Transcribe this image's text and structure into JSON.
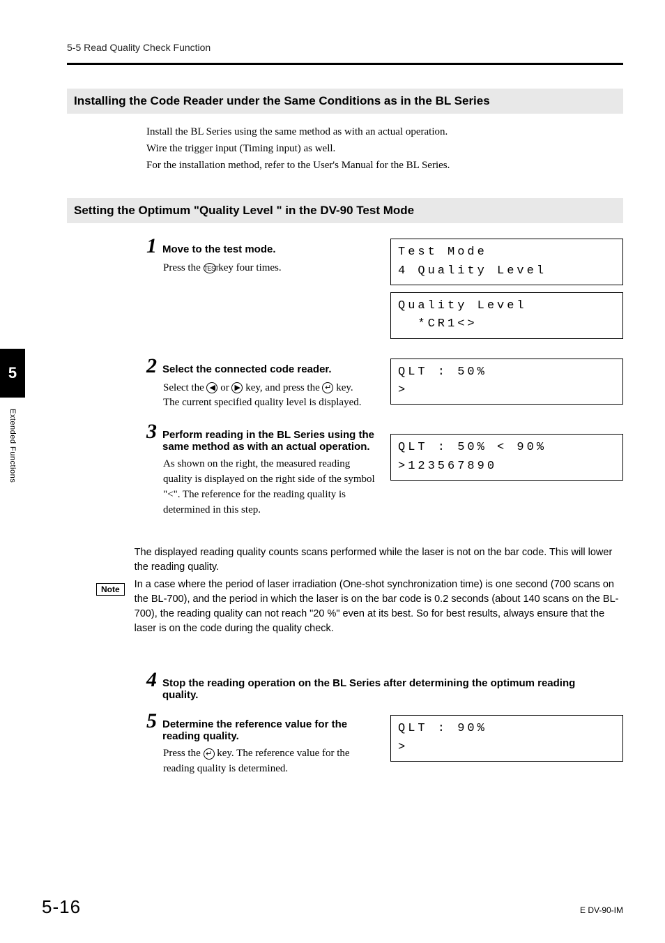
{
  "header": {
    "breadcrumb": "5-5  Read Quality Check Function"
  },
  "section1": {
    "title": "Installing the Code Reader under the Same Conditions as in the BL Series",
    "p1": "Install the BL Series using the same method as with an actual operation.",
    "p2": "Wire the trigger input (Timing input) as well.",
    "p3": "For the installation method, refer to the User's Manual for the BL Series."
  },
  "section2": {
    "title": "Setting the Optimum \"Quality Level \" in the DV-90 Test Mode"
  },
  "steps": {
    "s1": {
      "num": "1",
      "title": "Move to the test mode.",
      "body_a": "Press the ",
      "icon": "TEST",
      "body_b": " key four times."
    },
    "s2": {
      "num": "2",
      "title": "Select the connected code reader.",
      "body_a": "Select the ",
      "icon_l": "◀",
      "body_b": " or ",
      "icon_r": "▶",
      "body_c": " key, and press the ",
      "icon_e": "↵",
      "body_d": " key.",
      "body_e": "The current specified quality level is displayed."
    },
    "s3": {
      "num": "3",
      "title": "Perform reading in the BL Series using the same method as with an actual operation.",
      "body": "As shown on the right, the measured reading quality is displayed on the right side of the symbol \"<\". The reference for the reading quality is determined in this step."
    },
    "s4": {
      "num": "4",
      "title": "Stop the reading operation on the BL Series after determining the optimum reading quality."
    },
    "s5": {
      "num": "5",
      "title": "Determine the reference value for the reading quality.",
      "body_a": "Press the ",
      "icon_e": "↵",
      "body_b": " key. The reference value for the reading quality is determined."
    }
  },
  "lcd": {
    "b1l1": "Test Mode",
    "b1l2": "4 Quality Level",
    "b2l1": "Quality Level",
    "b2l2": "  *CR1<>",
    "b3l1": "QLT : 50%",
    "b3l2": ">",
    "b4l1": "QLT : 50% < 90%",
    "b4l2": ">123567890",
    "b5l1": "QLT : 90%",
    "b5l2": ">"
  },
  "note": {
    "badge": "Note",
    "p1": "The displayed reading quality counts scans performed while the laser is not on the bar code. This will lower the reading quality.",
    "p2": "In a case where the period of laser irradiation (One-shot synchronization time) is one second (700 scans on the BL-700), and the period in which the laser is on the bar code is 0.2 seconds (about 140 scans on the BL-700), the reading quality can not reach \"20 %\" even at its best. So for best results, always ensure that the laser is on the code during the quality check."
  },
  "side": {
    "chapter": "5",
    "label": "Extended Functions"
  },
  "footer": {
    "page": "5-16",
    "docid": "E DV-90-IM"
  }
}
